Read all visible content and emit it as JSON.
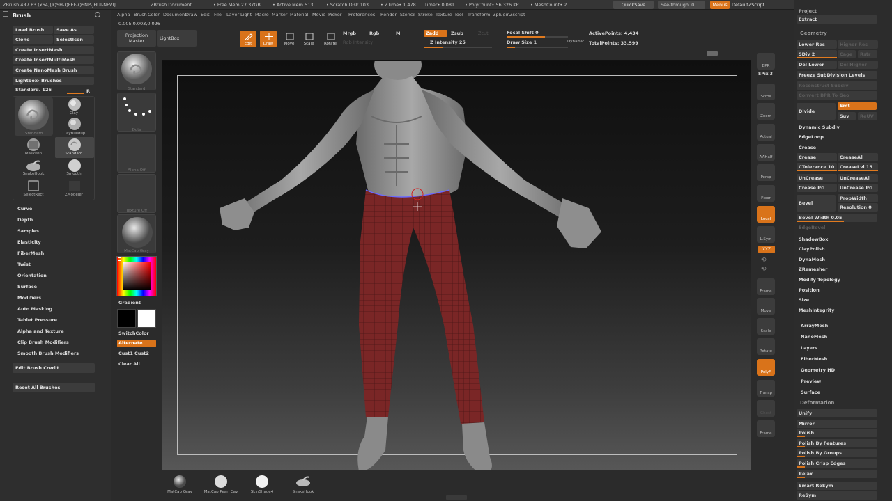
{
  "titlebar": {
    "app": "ZBrush 4R7 P3 (x64)[IQSH-QFEF-QSNP-JHUI-NFVI]",
    "doc": "ZBrush Document",
    "free_mem": "• Free Mem 27.37GB",
    "active_mem": "• Active Mem 513",
    "scratch": "• Scratch Disk 103",
    "ztime": "• ZTime• 1.478",
    "timer": "Timer• 0.081",
    "polycount": "• PolyCount• 56.326 KP",
    "meshcount": "• MeshCount• 2",
    "quicksave": "QuickSave",
    "see_through": "See-through",
    "see_through_value": "0",
    "menus_btn": "Menus",
    "default_script": "DefaultZScript"
  },
  "menus": [
    "Alpha",
    "Brush",
    "Color",
    "Document",
    "Draw",
    "Edit",
    "File",
    "Layer",
    "Light",
    "Macro",
    "Marker",
    "Material",
    "Movie",
    "Picker",
    "Preferences",
    "Render",
    "Stencil",
    "Stroke",
    "Texture",
    "Tool",
    "Transform",
    "Zplugin",
    "Zscript"
  ],
  "coords": "0.005,0.003,0.026",
  "left": {
    "header": "Brush",
    "load_brush": "Load Brush",
    "save_as": "Save As",
    "clone": "Clone",
    "select_icon": "SelectIcon",
    "create_insert_mesh": "Create InsertMesh",
    "create_insert_multi_mesh": "Create InsertMultiMesh",
    "create_nanomesh_brush": "Create NanoMesh Brush",
    "lightbox_brushes": "Lightbox› Brushes",
    "standard_label": "Standard. 126",
    "r_label": "R",
    "brushes": [
      {
        "name": "Clay"
      },
      {
        "name": "ClayBuildup"
      },
      {
        "name": "MaskPen"
      },
      {
        "name": "Standard"
      },
      {
        "name": "SnakeHook"
      },
      {
        "name": "Smooth"
      },
      {
        "name": "SelectRect"
      },
      {
        "name": "ZModeler"
      }
    ],
    "big_brush": "Standard",
    "subpalettes": [
      "Curve",
      "Depth",
      "Samples",
      "Elasticity",
      "FiberMesh",
      "Twist",
      "Orientation",
      "Surface",
      "Modifiers",
      "Auto Masking",
      "Tablet Pressure",
      "Alpha and Texture",
      "Clip Brush Modifiers",
      "Smooth Brush Modifiers"
    ],
    "edit_brush_credit": "Edit Brush Credit",
    "reset_all_brushes": "Reset All Brushes"
  },
  "topshelf": {
    "projection_master": "Projection Master",
    "lightbox": "LightBox",
    "edit": "Edit",
    "draw": "Draw",
    "move": "Move",
    "scale": "Scale",
    "rotate": "Rotate",
    "mrgb": "Mrgb",
    "rgb": "Rgb",
    "m": "M",
    "rgb_intensity": "Rgb Intensity",
    "zadd": "Zadd",
    "zsub": "Zsub",
    "zcut": "Zcut",
    "z_intensity": "Z Intensity 25",
    "focal_shift": "Focal Shift 0",
    "draw_size": "Draw Size 1",
    "dynamic": "Dynamic",
    "active_points": "ActivePoints: 4,434",
    "total_points": "TotalPoints: 33,599"
  },
  "thumbs": {
    "brush": "Standard",
    "stroke": "Dots",
    "alpha": "Alpha Off",
    "texture": "Texture Off",
    "material": "MatCap Gray",
    "gradient": "Gradient",
    "switch_color": "SwitchColor",
    "alternate": "Alternate",
    "cust1": "Cust1",
    "cust2": "Cust2",
    "clear_all": "Clear All"
  },
  "shelf": {
    "bpr": "BPR",
    "spix": "SPix 3",
    "scroll": "Scroll",
    "zoom": "Zoom",
    "actual": "Actual",
    "aahalf": "AAHalf",
    "persp": "Persp",
    "floor": "Floor",
    "local": "Local",
    "lsym": "L.Sym",
    "xyz": "XYZ",
    "frame": "Frame",
    "move": "Move",
    "scale": "Scale",
    "rotate": "Rotate",
    "polyf": "PolyF",
    "transp": "Transp",
    "solo": "Solo",
    "ghost": "Ghost"
  },
  "right": {
    "project": "Project",
    "extract": "Extract",
    "geometry": "Geometry",
    "lower_res": "Lower Res",
    "higher_res": "Higher Res",
    "sdiv": "SDiv 2",
    "cage": "Cage",
    "rstr": "Rstr",
    "del_lower": "Del Lower",
    "del_higher": "Del Higher",
    "freeze_subdiv": "Freeze SubDivision Levels",
    "reconstruct_subdiv": "Reconstruct Subdiv",
    "convert_bpr": "Convert BPR To Geo",
    "divide": "Divide",
    "smt": "Smt",
    "suv": "Suv",
    "relp": "ReUV",
    "dynamic_subdiv": "Dynamic Subdiv",
    "edgeloop": "EdgeLoop",
    "crease_header": "Crease",
    "crease": "Crease",
    "crease_all": "CreaseAll",
    "ctolerance": "CTolerance 10",
    "crease_lvl": "CreaseLvl 15",
    "uncrease": "UnCrease",
    "uncrease_all": "UnCreaseAll",
    "crease_pg": "Crease PG",
    "uncrease_pg": "UnCrease PG",
    "bevel": "Bevel",
    "prop_width": "PropWidth",
    "resolution": "Resolution 0",
    "bevel_width": "Bevel Width 0.05",
    "edge_bevel": "EdgeBevel",
    "sections": [
      "ShadowBox",
      "ClayPolish",
      "DynaMesh",
      "ZRemesher",
      "Modify Topology",
      "Position",
      "Size",
      "MeshIntegrity"
    ],
    "palettes": [
      "ArrayMesh",
      "NanoMesh",
      "Layers",
      "FiberMesh",
      "Geometry HD",
      "Preview",
      "Surface"
    ],
    "deformation": "Deformation",
    "deform_items": [
      {
        "label": "Unify",
        "fill": 0
      },
      {
        "label": "Mirror",
        "fill": 0
      },
      {
        "label": "Polish",
        "fill": 0.1
      },
      {
        "label": "Polish By Features",
        "fill": 0.1
      },
      {
        "label": "Polish By Groups",
        "fill": 0.1
      },
      {
        "label": "Polish Crisp Edges",
        "fill": 0.1
      },
      {
        "label": "Relax",
        "fill": 0.1
      },
      {
        "label": "Smart ReSym",
        "fill": 0
      },
      {
        "label": "ReSym",
        "fill": 0
      }
    ]
  },
  "bottom": {
    "materials": [
      "MatCap Gray",
      "MatCap Pearl Cav",
      "SkinShade4",
      "SnakeHook"
    ]
  },
  "colors": {
    "accent": "#d9731a",
    "pants": "#7a2626",
    "skin": "#9a9a9a"
  }
}
